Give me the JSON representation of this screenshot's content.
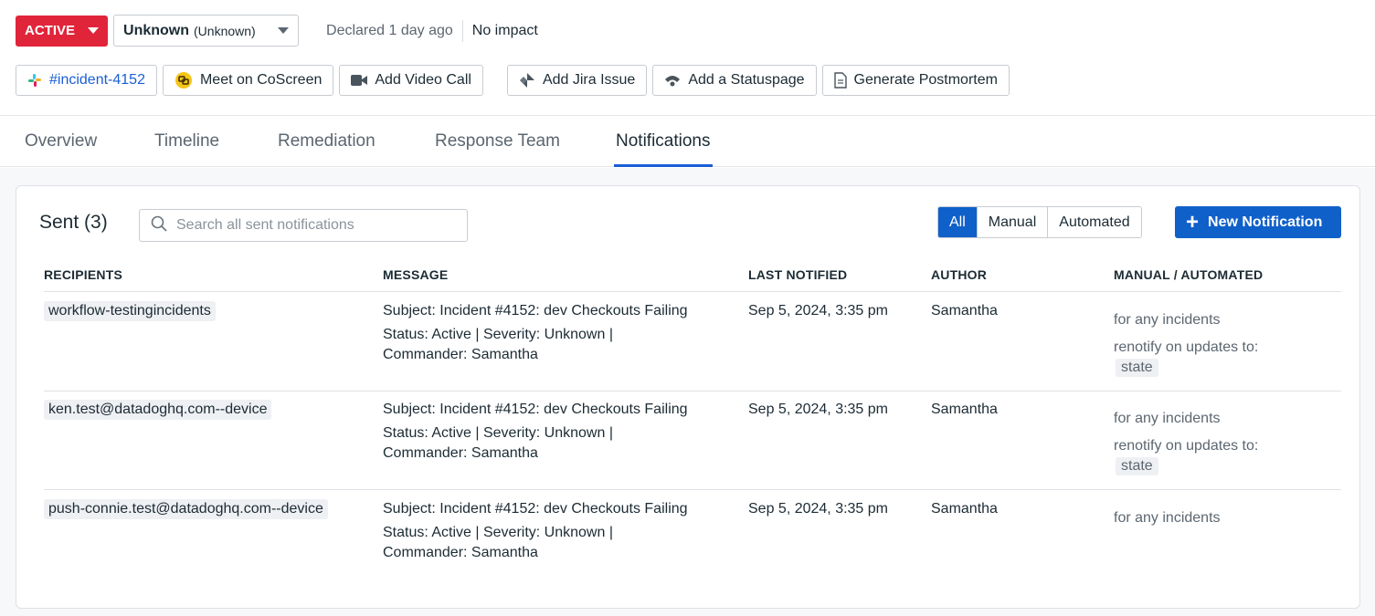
{
  "header": {
    "status_label": "ACTIVE",
    "severity_main": "Unknown",
    "severity_sub": "(Unknown)",
    "declared": "Declared 1 day ago",
    "impact": "No impact"
  },
  "actions": {
    "slack_channel": "#incident-4152",
    "coscreen": "Meet on CoScreen",
    "video_call": "Add Video Call",
    "jira": "Add Jira Issue",
    "statuspage": "Add a Statuspage",
    "postmortem": "Generate Postmortem"
  },
  "tabs": [
    {
      "label": "Overview"
    },
    {
      "label": "Timeline"
    },
    {
      "label": "Remediation"
    },
    {
      "label": "Response Team"
    },
    {
      "label": "Notifications"
    }
  ],
  "active_tab": "Notifications",
  "panel": {
    "title": "Sent (3)",
    "search_placeholder": "Search all sent notifications",
    "filters": [
      "All",
      "Manual",
      "Automated"
    ],
    "selected_filter": "All",
    "new_button": "New Notification"
  },
  "table": {
    "columns": [
      "RECIPIENTS",
      "MESSAGE",
      "LAST NOTIFIED",
      "AUTHOR",
      "MANUAL / AUTOMATED"
    ],
    "rows": [
      {
        "recipient": "workflow-testingincidents",
        "subject": "Subject: Incident #4152: dev Checkouts Failing",
        "body1": "Status: Active | Severity: Unknown |",
        "body2": "Commander: Samantha",
        "last_notified": "Sep 5, 2024, 3:35 pm",
        "author": "Samantha",
        "rule": "for any incidents",
        "renotify": "renotify on updates to:",
        "renotify_field": "state"
      },
      {
        "recipient": "ken.test@datadoghq.com--device",
        "subject": "Subject: Incident #4152: dev Checkouts Failing",
        "body1": "Status: Active | Severity: Unknown |",
        "body2": "Commander: Samantha",
        "last_notified": "Sep 5, 2024, 3:35 pm",
        "author": "Samantha",
        "rule": "for any incidents",
        "renotify": "renotify on updates to:",
        "renotify_field": "state"
      },
      {
        "recipient": "push-connie.test@datadoghq.com--device",
        "subject": "Subject: Incident #4152: dev Checkouts Failing",
        "body1": "Status: Active | Severity: Unknown |",
        "body2": "Commander: Samantha",
        "last_notified": "Sep 5, 2024, 3:35 pm",
        "author": "Samantha",
        "rule": "for any incidents"
      }
    ]
  },
  "colors": {
    "active_red": "#e0243a",
    "primary_blue": "#1060c9",
    "link_blue": "#1a5ed6"
  }
}
